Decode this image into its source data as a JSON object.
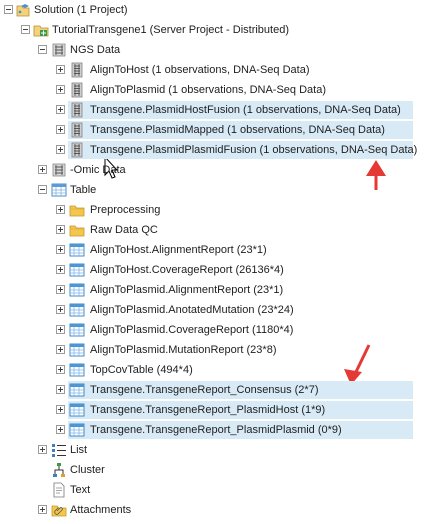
{
  "tree": {
    "rows": [
      {
        "label": "Solution (1 Project)",
        "icon": "solution-icon",
        "expander": "minus"
      },
      {
        "label": "TutorialTransgene1 (Server Project - Distributed)",
        "icon": "project-icon",
        "expander": "minus"
      },
      {
        "label": "NGS Data",
        "icon": "ngs-folder-icon",
        "expander": "minus"
      },
      {
        "label": "AlignToHost (1 observations, DNA-Seq Data)",
        "icon": "dna-data-icon",
        "expander": "plus"
      },
      {
        "label": "AlignToPlasmid (1 observations, DNA-Seq Data)",
        "icon": "dna-data-icon",
        "expander": "plus"
      },
      {
        "label": "Transgene.PlasmidHostFusion (1 observations, DNA-Seq Data)",
        "icon": "dna-data-icon",
        "expander": "plus",
        "highlighted": true
      },
      {
        "label": "Transgene.PlasmidMapped (1 observations, DNA-Seq Data)",
        "icon": "dna-data-icon",
        "expander": "plus",
        "highlighted": true
      },
      {
        "label": "Transgene.PlasmidPlasmidFusion (1 observations, DNA-Seq Data)",
        "icon": "dna-data-icon",
        "expander": "plus",
        "highlighted": true
      },
      {
        "label": "-Omic Data",
        "icon": "omic-folder-icon",
        "expander": "plus"
      },
      {
        "label": "Table",
        "icon": "table-folder-icon",
        "expander": "minus"
      },
      {
        "label": "Preprocessing",
        "icon": "folder-icon",
        "expander": "plus"
      },
      {
        "label": "Raw Data QC",
        "icon": "folder-icon",
        "expander": "plus"
      },
      {
        "label": "AlignToHost.AlignmentReport (23*1)",
        "icon": "table-icon",
        "expander": "plus"
      },
      {
        "label": "AlignToHost.CoverageReport (26136*4)",
        "icon": "table-icon",
        "expander": "plus"
      },
      {
        "label": "AlignToPlasmid.AlignmentReport (23*1)",
        "icon": "table-icon",
        "expander": "plus"
      },
      {
        "label": "AlignToPlasmid.AnotatedMutation (23*24)",
        "icon": "table-icon",
        "expander": "plus"
      },
      {
        "label": "AlignToPlasmid.CoverageReport (1180*4)",
        "icon": "table-icon",
        "expander": "plus"
      },
      {
        "label": "AlignToPlasmid.MutationReport (23*8)",
        "icon": "table-icon",
        "expander": "plus"
      },
      {
        "label": "TopCovTable (494*4)",
        "icon": "table-icon",
        "expander": "plus"
      },
      {
        "label": "Transgene.TransgeneReport_Consensus (2*7)",
        "icon": "table-icon",
        "expander": "plus",
        "highlighted": true
      },
      {
        "label": "Transgene.TransgeneReport_PlasmidHost (1*9)",
        "icon": "table-icon",
        "expander": "plus",
        "highlighted": true
      },
      {
        "label": "Transgene.TransgeneReport_PlasmidPlasmid (0*9)",
        "icon": "table-icon",
        "expander": "plus",
        "highlighted": true
      },
      {
        "label": "List",
        "icon": "list-icon",
        "expander": "plus"
      },
      {
        "label": "Cluster",
        "icon": "cluster-icon",
        "expander": "none"
      },
      {
        "label": "Text",
        "icon": "text-icon",
        "expander": "none"
      },
      {
        "label": "Attachments",
        "icon": "attachments-icon",
        "expander": "plus"
      }
    ]
  },
  "colors": {
    "highlight": "#d9eaf7",
    "annotation_arrow": "#e53935"
  }
}
